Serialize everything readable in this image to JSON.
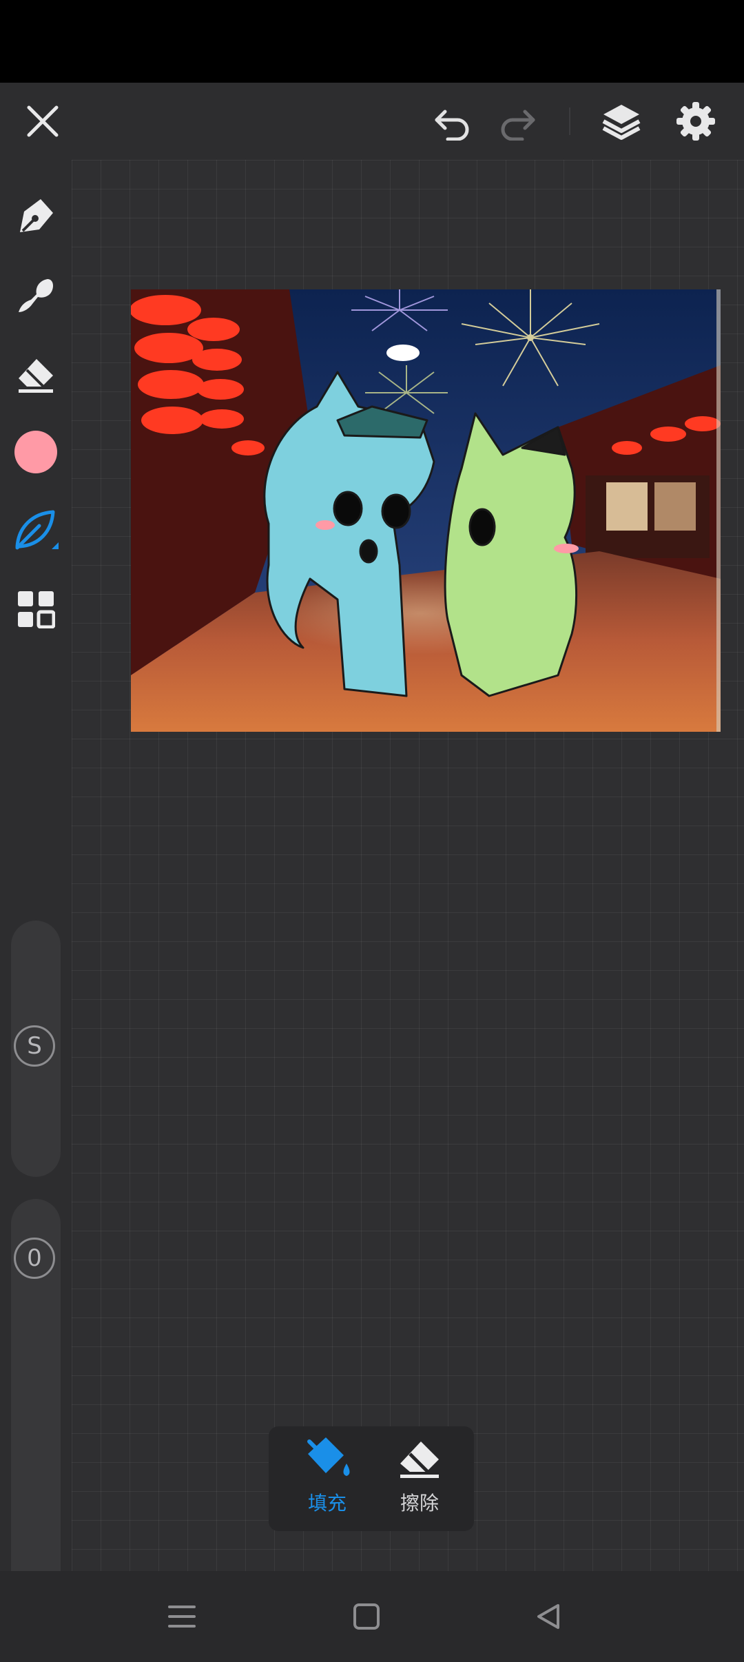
{
  "topbar": {
    "icons": [
      "close-icon",
      "undo-icon",
      "redo-icon",
      "layers-icon",
      "gear-icon"
    ]
  },
  "toolbar": {
    "tools": [
      "pen-icon",
      "smudge-brush-icon",
      "eraser-icon",
      "color-swatch",
      "leaf-brush-icon",
      "grid-menu-icon"
    ],
    "active_tool": "leaf-brush-icon",
    "current_color": "#ff9aa6",
    "accent_color": "#1a8fe8"
  },
  "sliders": {
    "size_label": "S",
    "opacity_label": "0"
  },
  "fill_popup": {
    "fill_label": "填充",
    "erase_label": "擦除",
    "active_item": "fill"
  },
  "navbar": {
    "icons": [
      "menu-icon",
      "home-icon",
      "back-icon"
    ]
  }
}
